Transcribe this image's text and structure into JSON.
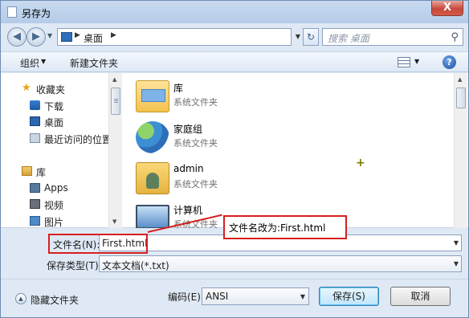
{
  "window": {
    "title": "另存为",
    "close_label": "X"
  },
  "address": {
    "back_label": "◀",
    "forward_label": "▶",
    "history_arrow": "▼",
    "separator": "▶",
    "location": "桌面",
    "dropdown_arrow": "▼",
    "refresh_label": "↻",
    "search_placeholder": "搜索 桌面",
    "search_icon_glyph": "⚲"
  },
  "toolbar": {
    "organize_label": "组织",
    "organize_arrow": "▼",
    "new_folder_label": "新建文件夹",
    "view_arrow": "▼",
    "help_label": "?"
  },
  "navpane": {
    "items": [
      {
        "label": "收藏夹",
        "icon": "star-icon",
        "glyph": "★"
      },
      {
        "label": "下载",
        "icon": "download-folder-icon"
      },
      {
        "label": "桌面",
        "icon": "desktop-icon"
      },
      {
        "label": "最近访问的位置",
        "icon": "recent-places-icon"
      },
      {
        "label": "库",
        "icon": "library-icon"
      },
      {
        "label": "Apps",
        "icon": "apps-icon"
      },
      {
        "label": "视频",
        "icon": "video-icon"
      },
      {
        "label": "图片",
        "icon": "pictures-icon"
      }
    ],
    "scroll_up": "▲",
    "scroll_down": "▼"
  },
  "files": [
    {
      "name": "库",
      "type": "系统文件夹",
      "icon": "library-folder-icon"
    },
    {
      "name": "家庭组",
      "type": "系统文件夹",
      "icon": "homegroup-icon"
    },
    {
      "name": "admin",
      "type": "系统文件夹",
      "icon": "user-folder-icon"
    },
    {
      "name": "计算机",
      "type": "系统文件夹",
      "icon": "computer-icon"
    }
  ],
  "cursor_glyph": "+",
  "filename": {
    "label": "文件名(N):",
    "value": "First.html",
    "dropdown_arrow": "▼"
  },
  "filetype": {
    "label": "保存类型(T):",
    "value": "文本文档(*.txt)"
  },
  "annotation": {
    "text": "文件名改为:First.html",
    "color": "#d61f1f"
  },
  "footer": {
    "hide_folders_label": "隐藏文件夹",
    "hide_folders_glyph": "▲",
    "encoding_label": "编码(E):",
    "encoding_value": "ANSI",
    "encoding_arrow": "▼",
    "save_label": "保存(S)",
    "cancel_label": "取消"
  }
}
